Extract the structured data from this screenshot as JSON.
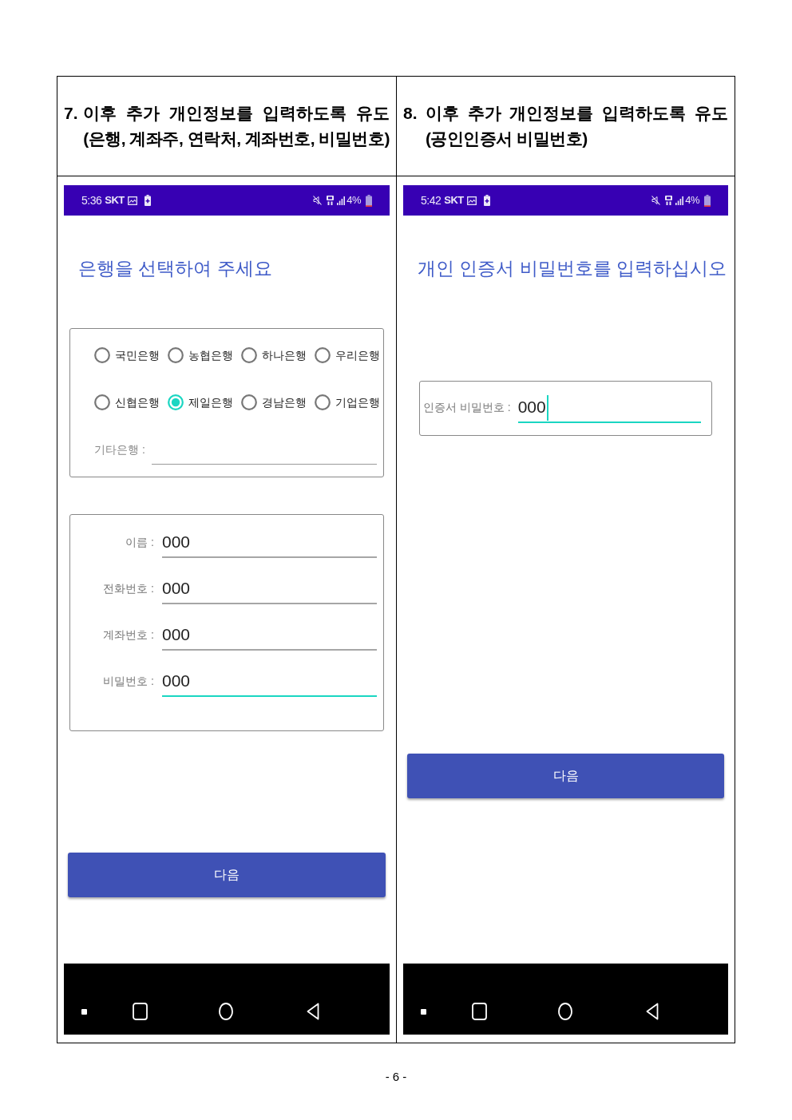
{
  "table": {
    "columns": [
      {
        "header": {
          "number": "7.",
          "title": "이후 추가 개인정보를 입력하도록 유도",
          "subtitle": "(은행, 계좌주, 연락처, 계좌번호, 비밀번호)"
        },
        "phone": {
          "status_bar": {
            "time": "5:36",
            "carrier": "SKT",
            "battery": "4%"
          },
          "heading": "은행을 선택하여 주세요",
          "sections": [
            {
              "kind": "radio_group",
              "options": [
                {
                  "label": "국민은행",
                  "selected": false
                },
                {
                  "label": "농협은행",
                  "selected": false
                },
                {
                  "label": "하나은행",
                  "selected": false
                },
                {
                  "label": "우리은행",
                  "selected": false
                },
                {
                  "label": "신협은행",
                  "selected": false
                },
                {
                  "label": "제일은행",
                  "selected": true
                },
                {
                  "label": "경남은행",
                  "selected": false
                },
                {
                  "label": "기업은행",
                  "selected": false
                }
              ],
              "other_field": {
                "label": "기타은행 :"
              }
            },
            {
              "kind": "form",
              "fields": [
                {
                  "label": "이름 :",
                  "value": "000",
                  "focused": false,
                  "cursor": false
                },
                {
                  "label": "전화번호 :",
                  "value": "000",
                  "focused": false,
                  "cursor": false
                },
                {
                  "label": "계좌번호 :",
                  "value": "000",
                  "focused": false,
                  "cursor": false
                },
                {
                  "label": "비밀번호 :",
                  "value": "000",
                  "focused": true,
                  "cursor": false
                }
              ]
            }
          ],
          "button": "다음"
        }
      },
      {
        "header": {
          "number": "8.",
          "title": "이후 추가 개인정보를 입력하도록 유도",
          "subtitle": "(공인인증서 비밀번호)"
        },
        "phone": {
          "status_bar": {
            "time": "5:42",
            "carrier": "SKT",
            "battery": "4%"
          },
          "heading": "개인 인증서 비밀번호를 입력하십시오",
          "sections": [
            {
              "kind": "single_field",
              "fields": [
                {
                  "label": "인증서 비밀번호 :",
                  "value": "000",
                  "focused": true,
                  "cursor": true
                }
              ]
            }
          ],
          "button": "다음"
        }
      }
    ]
  },
  "page_number": "- 6 -"
}
